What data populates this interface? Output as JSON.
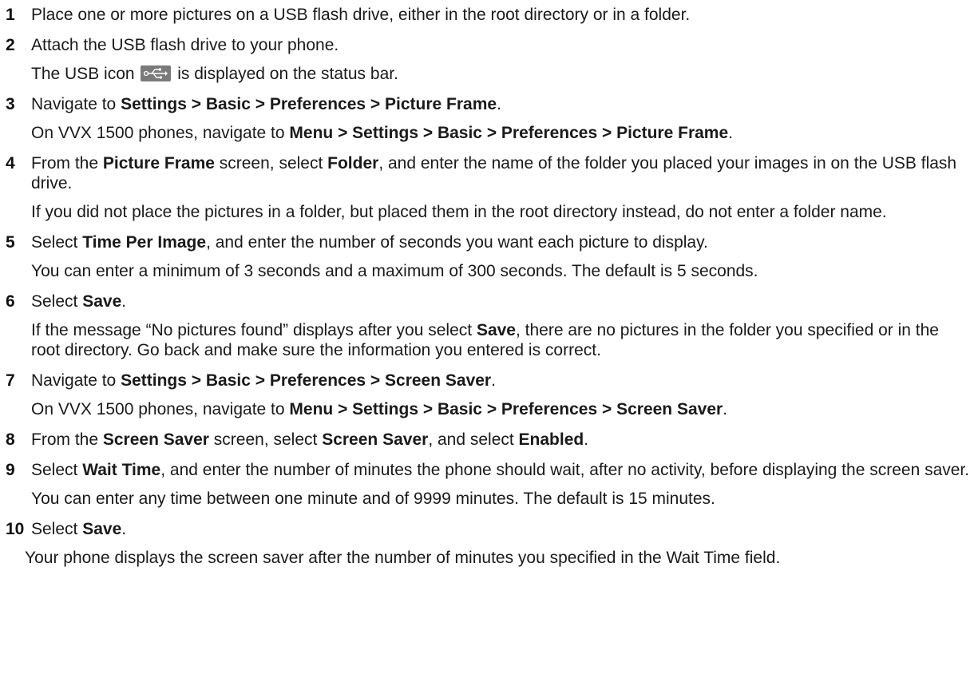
{
  "steps": [
    {
      "num": "1",
      "parts": [
        "Place one or more pictures on a USB flash drive, either in the root directory or in a folder."
      ]
    },
    {
      "num": "2",
      "parts": [
        "Attach the USB flash drive to your phone."
      ],
      "note": {
        "before": "The USB icon",
        "icon": "usb-icon",
        "after": "is displayed on the status bar."
      }
    },
    {
      "num": "3",
      "parts": [
        "Navigate to ",
        "Settings > Basic > Preferences > Picture Frame",
        "."
      ],
      "note_parts": [
        "On VVX 1500 phones, navigate to ",
        "Menu > Settings > Basic > Preferences > Picture Frame",
        "."
      ]
    },
    {
      "num": "4",
      "parts": [
        "From the ",
        "Picture Frame",
        " screen, select ",
        "Folder",
        ", and enter the name of the folder you placed your images in on the USB flash drive."
      ],
      "note": "If you did not place the pictures in a folder, but placed them in the root directory instead, do not enter a folder name."
    },
    {
      "num": "5",
      "parts": [
        "Select ",
        "Time Per Image",
        ", and enter the number of seconds you want each picture to display."
      ],
      "note": "You can enter a minimum of 3 seconds and a maximum of 300 seconds. The default is 5 seconds."
    },
    {
      "num": "6",
      "parts": [
        "Select ",
        "Save",
        "."
      ],
      "note_parts": [
        "If the message “No pictures found” displays after you select ",
        "Save",
        ", there are no pictures in the folder you specified or in the root directory. Go back and make sure the information you entered is correct."
      ]
    },
    {
      "num": "7",
      "parts": [
        "Navigate to ",
        "Settings > Basic > Preferences > Screen Saver",
        "."
      ],
      "note_parts": [
        "On VVX 1500 phones, navigate to ",
        "Menu > Settings > Basic > Preferences > Screen Saver",
        "."
      ]
    },
    {
      "num": "8",
      "parts": [
        "From the ",
        "Screen Saver",
        " screen, select ",
        "Screen Saver",
        ", and select ",
        "Enabled",
        "."
      ]
    },
    {
      "num": "9",
      "parts": [
        "Select ",
        "Wait Time",
        ", and enter the number of minutes the phone should wait, after no activity, before displaying the screen saver."
      ],
      "note": "You can enter any time between one minute and of 9999 minutes. The default is 15 minutes."
    },
    {
      "num": "10",
      "parts": [
        "Select ",
        "Save",
        "."
      ],
      "note": "Your phone displays the screen saver after the number of minutes you specified in the Wait Time field."
    }
  ]
}
